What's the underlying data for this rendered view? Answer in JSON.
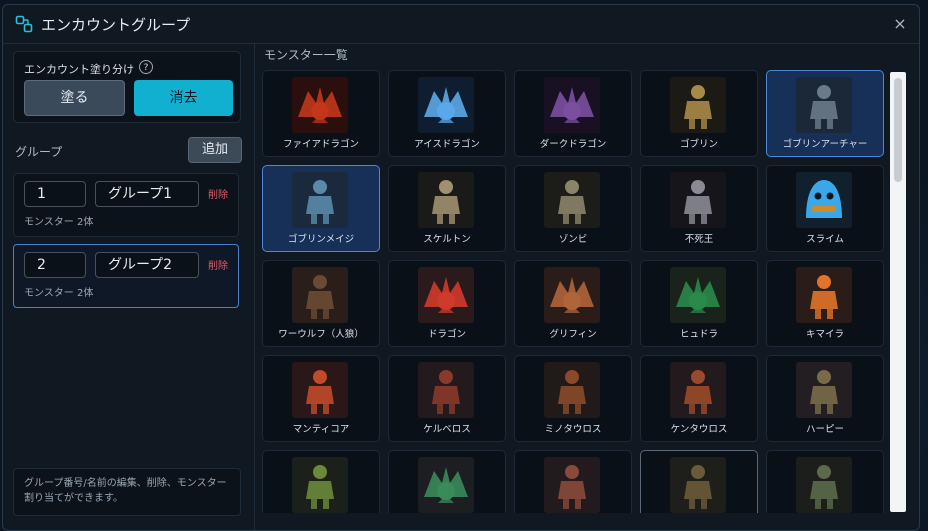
{
  "dialog": {
    "title": "エンカウントグループ",
    "close_glyph": "×"
  },
  "paint": {
    "label": "エンカウント塗り分け",
    "help_glyph": "?",
    "paint_label": "塗る",
    "clear_label": "消去"
  },
  "groups": {
    "heading": "グループ",
    "add_label": "追加",
    "items": [
      {
        "number": "1",
        "name": "グループ1",
        "delete_label": "削除",
        "count": "モンスター 2体",
        "selected": false
      },
      {
        "number": "2",
        "name": "グループ2",
        "delete_label": "削除",
        "count": "モンスター 2体",
        "selected": true
      }
    ],
    "hint": "グループ番号/名前の編集、削除、モンスター割り当てができます。"
  },
  "monsters": {
    "heading": "モンスター一覧",
    "items": [
      {
        "name": "ファイアドラゴン",
        "color": "#c2361c",
        "bg": "#2a0f0c",
        "icon": "dragon",
        "state": ""
      },
      {
        "name": "アイスドラゴン",
        "color": "#5aa8e8",
        "bg": "#0e1e30",
        "icon": "dragon",
        "state": ""
      },
      {
        "name": "ダークドラゴン",
        "color": "#7b4fa0",
        "bg": "#1a1024",
        "icon": "dragon",
        "state": ""
      },
      {
        "name": "ゴブリン",
        "color": "#a88a48",
        "bg": "#1c1a14",
        "icon": "humanoid",
        "state": ""
      },
      {
        "name": "ゴブリンアーチャー",
        "color": "#6a7a8a",
        "bg": "#1a2838",
        "icon": "humanoid",
        "state": "sel"
      },
      {
        "name": "ゴブリンメイジ",
        "color": "#5a8aa8",
        "bg": "#1a2a3c",
        "icon": "humanoid",
        "state": "sel"
      },
      {
        "name": "スケルトン",
        "color": "#a09070",
        "bg": "#1a1a18",
        "icon": "humanoid",
        "state": ""
      },
      {
        "name": "ゾンビ",
        "color": "#8a8468",
        "bg": "#1c1c18",
        "icon": "humanoid",
        "state": ""
      },
      {
        "name": "不死王",
        "color": "#8a8a92",
        "bg": "#16161a",
        "icon": "humanoid",
        "state": ""
      },
      {
        "name": "スライム",
        "color": "#3aa8e8",
        "bg": "#10202c",
        "icon": "slime",
        "state": ""
      },
      {
        "name": "ワーウルフ（人狼）",
        "color": "#6a4a34",
        "bg": "#2a1e1a",
        "icon": "humanoid",
        "state": ""
      },
      {
        "name": "ドラゴン",
        "color": "#d03a2a",
        "bg": "#2a1a1c",
        "icon": "dragon",
        "state": ""
      },
      {
        "name": "グリフィン",
        "color": "#b0643a",
        "bg": "#2a1c18",
        "icon": "dragon",
        "state": ""
      },
      {
        "name": "ヒュドラ",
        "color": "#2a8a4a",
        "bg": "#1a221c",
        "icon": "dragon",
        "state": ""
      },
      {
        "name": "キマイラ",
        "color": "#e0742a",
        "bg": "#2a1c18",
        "icon": "humanoid",
        "state": ""
      },
      {
        "name": "マンティコア",
        "color": "#c04a2a",
        "bg": "#2a1818",
        "icon": "humanoid",
        "state": ""
      },
      {
        "name": "ケルベロス",
        "color": "#8a3a2a",
        "bg": "#221a1c",
        "icon": "humanoid",
        "state": ""
      },
      {
        "name": "ミノタウロス",
        "color": "#8a4a2a",
        "bg": "#221a18",
        "icon": "humanoid",
        "state": ""
      },
      {
        "name": "ケンタウロス",
        "color": "#9a4a2a",
        "bg": "#221a1c",
        "icon": "humanoid",
        "state": ""
      },
      {
        "name": "ハーピー",
        "color": "#7a6a4a",
        "bg": "#221e22",
        "icon": "humanoid",
        "state": ""
      },
      {
        "name": "",
        "color": "#6a8a3a",
        "bg": "#1c201a",
        "icon": "humanoid",
        "state": ""
      },
      {
        "name": "",
        "color": "#3a8a5a",
        "bg": "#1c1e22",
        "icon": "dragon",
        "state": ""
      },
      {
        "name": "",
        "color": "#8a4a3a",
        "bg": "#221a1c",
        "icon": "humanoid",
        "state": ""
      },
      {
        "name": "",
        "color": "#6a5a3a",
        "bg": "#1e1e1a",
        "icon": "humanoid",
        "state": "outline"
      },
      {
        "name": "",
        "color": "#5a6a4a",
        "bg": "#1c1e1c",
        "icon": "humanoid",
        "state": ""
      }
    ]
  }
}
